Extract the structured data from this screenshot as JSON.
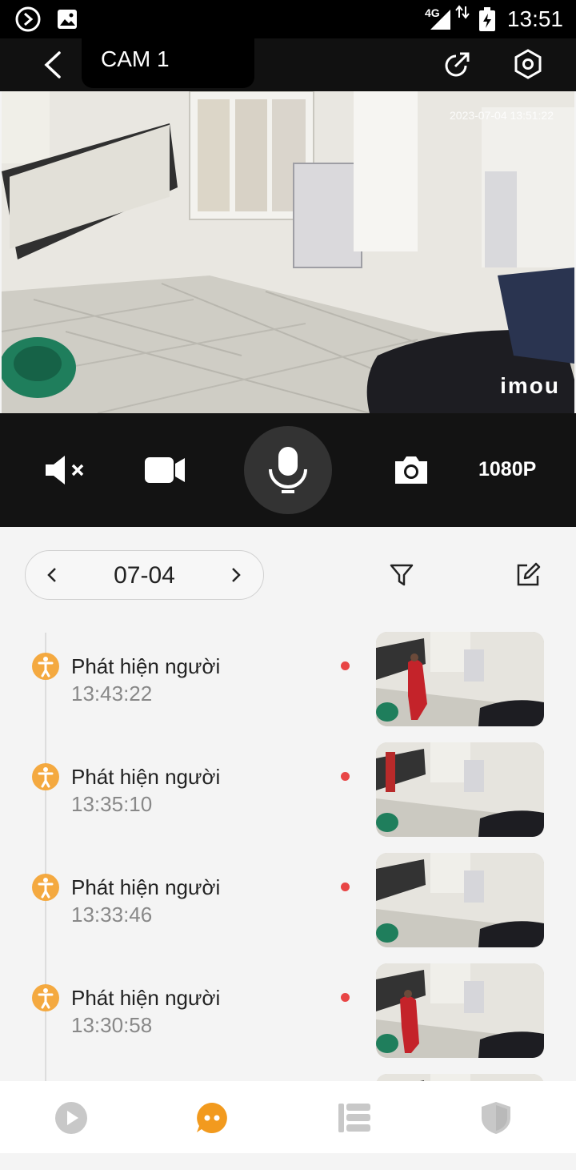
{
  "status_bar": {
    "time": "13:51",
    "network": "4G"
  },
  "header": {
    "title": "CAM 1"
  },
  "video": {
    "timestamp": "2023-07-04 13:51:22",
    "watermark": "imou"
  },
  "controls": {
    "resolution": "1080P"
  },
  "date_selector": {
    "date": "07-04"
  },
  "events": [
    {
      "label": "Phát hiện người",
      "time": "13:43:22"
    },
    {
      "label": "Phát hiện người",
      "time": "13:35:10"
    },
    {
      "label": "Phát hiện người",
      "time": "13:33:46"
    },
    {
      "label": "Phát hiện người",
      "time": "13:30:58"
    }
  ],
  "colors": {
    "accent": "#f29a1e",
    "event_icon": "#f4a940",
    "unread_dot": "#e84545",
    "nav_inactive": "#c8c8c8"
  }
}
